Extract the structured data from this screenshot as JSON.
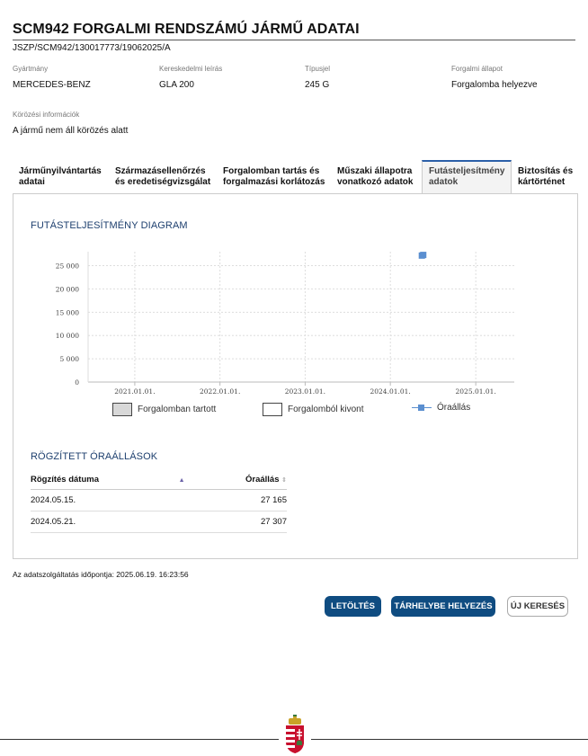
{
  "header": {
    "title": "SCM942 FORGALMI RENDSZÁMÚ JÁRMŰ ADATAI",
    "reference": "JSZP/SCM942/130017773/19062025/A"
  },
  "fields": [
    {
      "label": "Gyártmány",
      "value": "MERCEDES-BENZ"
    },
    {
      "label": "Kereskedelmi leírás",
      "value": "GLA 200"
    },
    {
      "label": "Típusjel",
      "value": "245 G"
    },
    {
      "label": "Forgalmi állapot",
      "value": "Forgalomba helyezve"
    }
  ],
  "wanted": {
    "label": "Körözési információk",
    "value": "A jármű nem áll körözés alatt"
  },
  "tabs": [
    {
      "line1": "Járműnyilvántartás",
      "line2": "adatai"
    },
    {
      "line1": "Származásellenőrzés",
      "line2": "és eredetiségvizsgálat"
    },
    {
      "line1": "Forgalomban tartás és",
      "line2": "forgalmazási korlátozás"
    },
    {
      "line1": "Műszaki állapotra",
      "line2": "vonatkozó adatok"
    },
    {
      "line1": "Futásteljesítmény",
      "line2": "adatok"
    },
    {
      "line1": "Biztosítás és",
      "line2": "kártörténet"
    }
  ],
  "active_tab": 4,
  "chart_section_title": "FUTÁSTELJESÍTMÉNY DIAGRAM",
  "chart_data": {
    "type": "scatter",
    "y_ticks": [
      "0",
      "5 000",
      "10 000",
      "15 000",
      "20 000",
      "25 000"
    ],
    "x_ticks": [
      "2021.01.01.",
      "2022.01.01.",
      "2023.01.01.",
      "2024.01.01.",
      "2025.01.01."
    ],
    "ylim": [
      0,
      28000
    ],
    "xlim": [
      "2020.06.15.",
      "2025.06.15."
    ],
    "grid": true,
    "series": [
      {
        "name": "Óraállás",
        "color": "#5b8fd0",
        "points": [
          {
            "x": "2024.05.15.",
            "y": 27165
          },
          {
            "x": "2024.05.21.",
            "y": 27307
          }
        ]
      }
    ],
    "legend": [
      {
        "name": "Forgalomban tartott",
        "swatch": "#d8d8d8"
      },
      {
        "name": "Forgalomból kivont",
        "swatch": "#ffffff"
      },
      {
        "name": "Óraállás",
        "swatch": "#5b8fd0"
      }
    ],
    "legend_position": "bottom"
  },
  "readings": {
    "title": "RÖGZÍTETT ÓRAÁLLÁSOK",
    "col_date": "Rögzítés dátuma",
    "col_value": "Óraállás",
    "rows": [
      {
        "date": "2024.05.15.",
        "value": "27 165"
      },
      {
        "date": "2024.05.21.",
        "value": "27 307"
      }
    ]
  },
  "footer": {
    "timestamp": "Az adatszolgáltatás időpontja: 2025.06.19. 16:23:56",
    "buttons": {
      "download": "LETÖLTÉS",
      "store": "TÁRHELYBE HELYEZÉS",
      "new_search": "ÚJ KERESÉS"
    }
  },
  "colors": {
    "primary": "#0f4c81",
    "section_title": "#1d3f6e",
    "series": "#5b8fd0"
  }
}
